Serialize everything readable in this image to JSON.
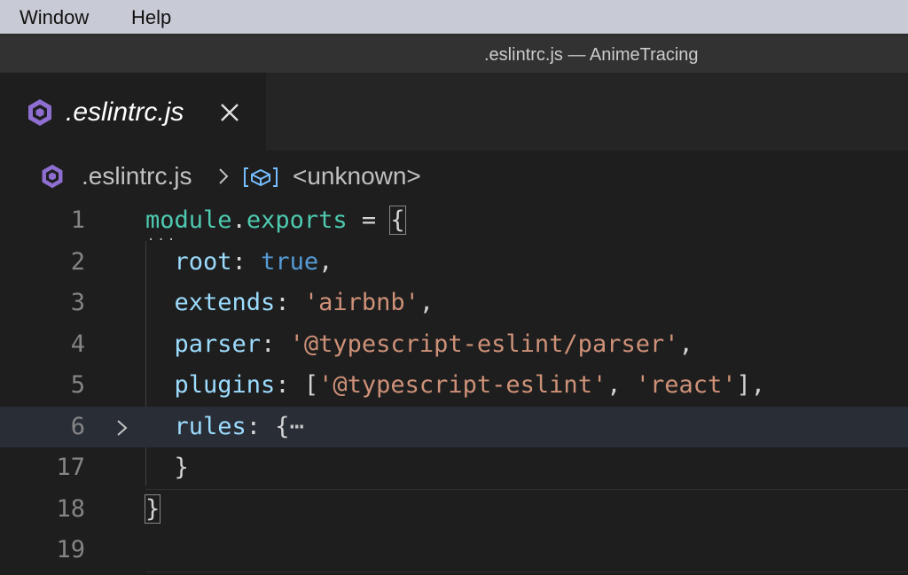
{
  "menubar": {
    "items": [
      "Window",
      "Help"
    ]
  },
  "window": {
    "title": ".eslintrc.js — AnimeTracing"
  },
  "tab": {
    "label": ".eslintrc.js",
    "icon": "eslint-file-icon",
    "close_icon": "close-icon"
  },
  "breadcrumb": {
    "file": ".eslintrc.js",
    "separator_icon": "chevron-right-icon",
    "symbol_icon": "symbol-module-icon",
    "symbol": "<unknown>"
  },
  "editor": {
    "current_line": "6",
    "lines": [
      {
        "number": "1",
        "tokens": [
          {
            "t": "module",
            "c": "var"
          },
          {
            "t": ".",
            "c": "punc"
          },
          {
            "t": "exports",
            "c": "var"
          },
          {
            "t": " = ",
            "c": "punc"
          },
          {
            "t": "{",
            "c": "punc"
          }
        ]
      },
      {
        "number": "2",
        "tokens": [
          {
            "t": "  ",
            "c": "punc"
          },
          {
            "t": "root",
            "c": "prop"
          },
          {
            "t": ": ",
            "c": "punc"
          },
          {
            "t": "true",
            "c": "bool"
          },
          {
            "t": ",",
            "c": "punc"
          }
        ]
      },
      {
        "number": "3",
        "tokens": [
          {
            "t": "  ",
            "c": "punc"
          },
          {
            "t": "extends",
            "c": "prop"
          },
          {
            "t": ": ",
            "c": "punc"
          },
          {
            "t": "'airbnb'",
            "c": "str"
          },
          {
            "t": ",",
            "c": "punc"
          }
        ]
      },
      {
        "number": "4",
        "tokens": [
          {
            "t": "  ",
            "c": "punc"
          },
          {
            "t": "parser",
            "c": "prop"
          },
          {
            "t": ": ",
            "c": "punc"
          },
          {
            "t": "'@typescript-eslint/parser'",
            "c": "str"
          },
          {
            "t": ",",
            "c": "punc"
          }
        ]
      },
      {
        "number": "5",
        "tokens": [
          {
            "t": "  ",
            "c": "punc"
          },
          {
            "t": "plugins",
            "c": "prop"
          },
          {
            "t": ": [",
            "c": "punc"
          },
          {
            "t": "'@typescript-eslint'",
            "c": "str"
          },
          {
            "t": ", ",
            "c": "punc"
          },
          {
            "t": "'react'",
            "c": "str"
          },
          {
            "t": "],",
            "c": "punc"
          }
        ]
      },
      {
        "number": "6",
        "tokens": [
          {
            "t": "  ",
            "c": "punc"
          },
          {
            "t": "rules",
            "c": "prop"
          },
          {
            "t": ": {",
            "c": "punc"
          },
          {
            "t": "⋯",
            "c": "ellipsis"
          }
        ]
      },
      {
        "number": "17",
        "tokens": [
          {
            "t": "  }",
            "c": "punc"
          }
        ]
      },
      {
        "number": "18",
        "tokens": [
          {
            "t": "}",
            "c": "punc"
          }
        ]
      },
      {
        "number": "19",
        "tokens": []
      }
    ]
  },
  "colors": {
    "variable": "#4ec9b0",
    "property": "#9cdcfe",
    "boolean": "#569cd6",
    "string": "#ce9178",
    "punctuation": "#d4d4d4",
    "eslint_icon": "#8f6ed1"
  }
}
